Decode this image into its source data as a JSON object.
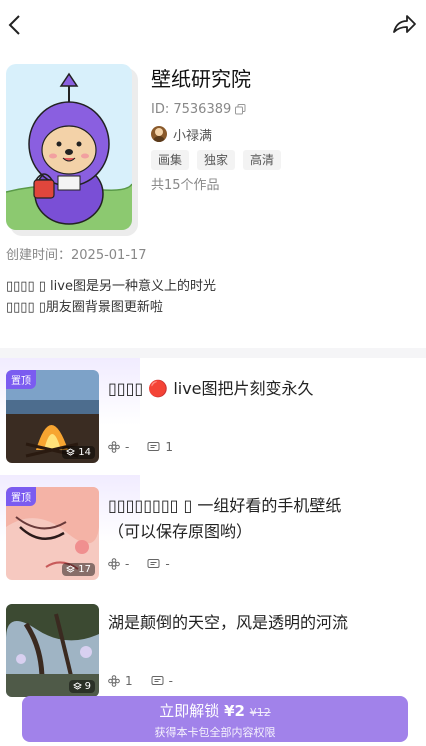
{
  "topbar": {
    "back_icon": "chevron-left-icon",
    "share_icon": "share-icon"
  },
  "collection": {
    "title": "壁纸研究院",
    "id_text": "ID: 7536389",
    "author": "小禄满",
    "tags": [
      "画集",
      "独家",
      "高清"
    ],
    "works_count": "共15个作品",
    "created": "创建时间：2025-01-17",
    "desc_line1": "▯▯▯▯ ▯ live图是另一种意义上的时光",
    "desc_line2": "▯▯▯▯ ▯朋友圈背景图更新啦"
  },
  "items": [
    {
      "pin": "置顶",
      "title_l1": "▯▯▯▯ 🔴 live图把片刻变永久",
      "title_l2": "",
      "image_count": "14",
      "likes": "-",
      "comments": "1"
    },
    {
      "pin": "置顶",
      "title_l1": "▯▯▯▯▯▯▯▯ ▯ 一组好看的手机壁纸",
      "title_l2": "（可以保存原图哟）",
      "image_count": "17",
      "likes": "-",
      "comments": "-"
    },
    {
      "pin": "",
      "title_l1": "湖是颠倒的天空，风是透明的河流",
      "title_l2": "",
      "image_count": "9",
      "likes": "1",
      "comments": "-"
    }
  ],
  "unlock": {
    "label": "立即解锁",
    "price": "¥2",
    "original_price": "¥12",
    "sub": "获得本卡包全部内容权限"
  },
  "colors": {
    "accent": "#a182ea",
    "pin": "#7b5cf0",
    "cover_bg": "#d8f0fb",
    "character": "#7a4fd6"
  }
}
